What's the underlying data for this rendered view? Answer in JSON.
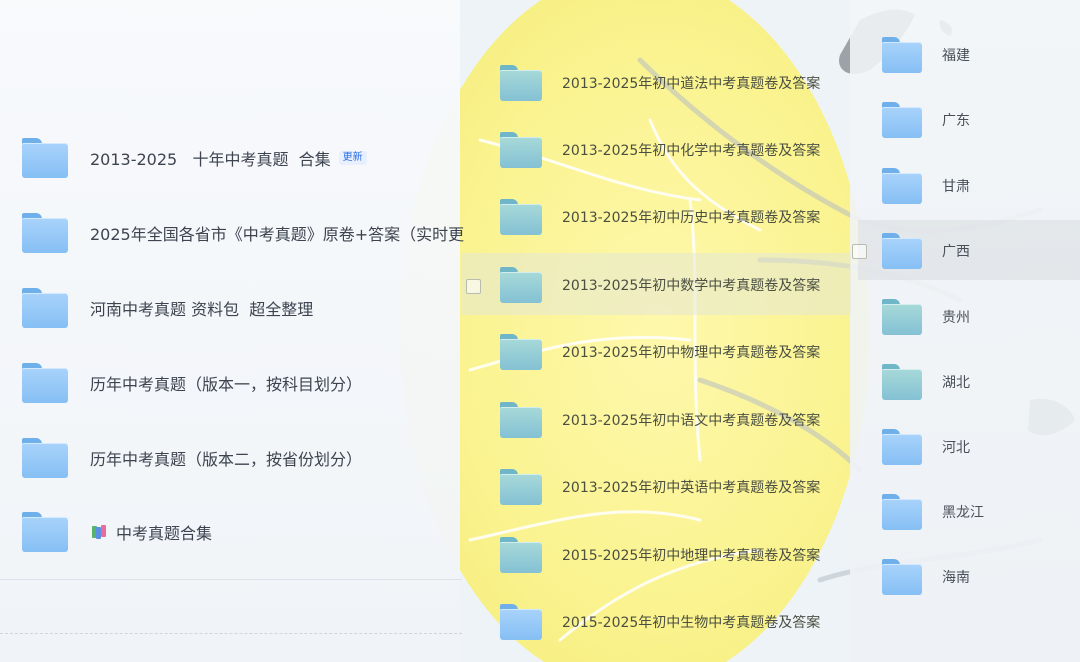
{
  "left_list": {
    "items": [
      {
        "label": "2013-2025   十年中考真题  合集",
        "badge": "更新"
      },
      {
        "label": "2025年全国各省市《中考真题》原卷+答案（实时更"
      },
      {
        "label": "河南中考真题 资料包  超全整理"
      },
      {
        "label": "历年中考真题（版本一，按科目划分）"
      },
      {
        "label": "历年中考真题（版本二，按省份划分）"
      },
      {
        "label": "中考真题合集",
        "icon": "books-icon"
      }
    ]
  },
  "middle_list": {
    "items": [
      {
        "label": "2013-2025年初中道法中考真题卷及答案"
      },
      {
        "label": "2013-2025年初中化学中考真题卷及答案"
      },
      {
        "label": "2013-2025年初中历史中考真题卷及答案"
      },
      {
        "label": "2013-2025年初中数学中考真题卷及答案"
      },
      {
        "label": "2013-2025年初中物理中考真题卷及答案"
      },
      {
        "label": "2013-2025年初中语文中考真题卷及答案"
      },
      {
        "label": "2013-2025年初中英语中考真题卷及答案"
      },
      {
        "label": "2015-2025年初中地理中考真题卷及答案"
      },
      {
        "label": "2015-2025年初中生物中考真题卷及答案"
      }
    ]
  },
  "right_list": {
    "items": [
      {
        "label": "福建"
      },
      {
        "label": "广东"
      },
      {
        "label": "甘肃"
      },
      {
        "label": "广西"
      },
      {
        "label": "贵州"
      },
      {
        "label": "湖北"
      },
      {
        "label": "河北"
      },
      {
        "label": "黑龙江"
      },
      {
        "label": "海南"
      }
    ]
  },
  "colors": {
    "folder_blue": "#8cc4f6",
    "folder_teal": "#8cc6d6",
    "badge_text": "#2a6fe0",
    "sun_yellow": "#f8f08a"
  }
}
